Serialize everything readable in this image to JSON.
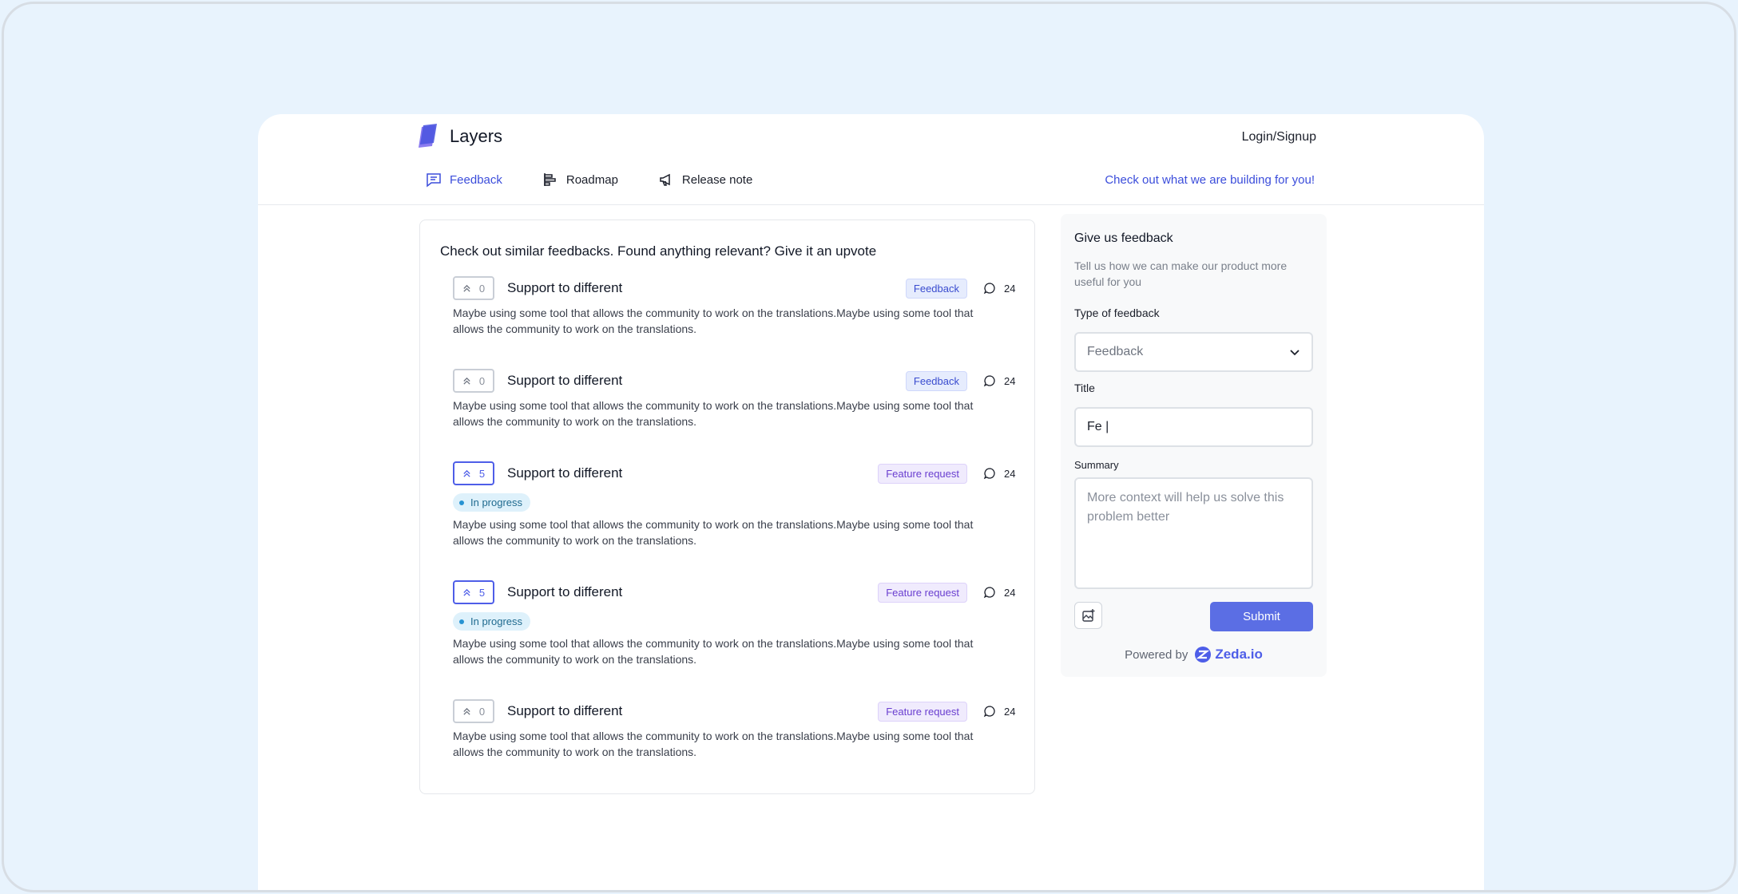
{
  "brand": {
    "name": "Layers",
    "logo_icon": "layers-logo-icon"
  },
  "header": {
    "login_label": "Login/Signup",
    "promo_link": "Check out what we are building for you!"
  },
  "nav": [
    {
      "label": "Feedback",
      "icon": "chat-icon",
      "active": true
    },
    {
      "label": "Roadmap",
      "icon": "roadmap-icon",
      "active": false
    },
    {
      "label": "Release note",
      "icon": "megaphone-icon",
      "active": false
    }
  ],
  "similar": {
    "heading": "Check out similar feedbacks. Found anything relevant? Give it an upvote",
    "items": [
      {
        "votes": "0",
        "upvoted": false,
        "title": "Support to different",
        "tag": "Feedback",
        "comments": "24",
        "status": "",
        "body": "Maybe using some tool that allows the community to work on the translations.Maybe using some tool that allows the community to work on the translations."
      },
      {
        "votes": "0",
        "upvoted": false,
        "title": "Support to different",
        "tag": "Feedback",
        "comments": "24",
        "status": "",
        "body": "Maybe using some tool that allows the community to work on the translations.Maybe using some tool that allows the community to work on the translations."
      },
      {
        "votes": "5",
        "upvoted": true,
        "title": "Support to different",
        "tag": "Feature request",
        "comments": "24",
        "status": "In progress",
        "body": "Maybe using some tool that allows the community to work on the translations.Maybe using some tool that allows the community to work on the translations."
      },
      {
        "votes": "5",
        "upvoted": true,
        "title": "Support to different",
        "tag": "Feature request",
        "comments": "24",
        "status": "In progress",
        "body": "Maybe using some tool that allows the community to work on the translations.Maybe using some tool that allows the community to work on the translations."
      },
      {
        "votes": "0",
        "upvoted": false,
        "title": "Support to different",
        "tag": "Feature request",
        "comments": "24",
        "status": "",
        "body": "Maybe using some tool that allows the community to work on the translations.Maybe using some tool that allows the community to work on the translations."
      }
    ]
  },
  "form": {
    "title": "Give us feedback",
    "subtitle": "Tell us how we can make our product more useful for you",
    "type_label": "Type of feedback",
    "type_value": "Feedback",
    "title_label": "Title",
    "title_value": "Fe |",
    "summary_label": "Summary",
    "summary_placeholder": "More context will help us solve this problem better",
    "submit_label": "Submit",
    "powered_by": "Powered by",
    "powered_brand": "Zeda.io"
  },
  "colors": {
    "accent": "#4e5ee8",
    "page_bg": "#e8f3fd",
    "submit_bg": "#5b6ee4"
  }
}
